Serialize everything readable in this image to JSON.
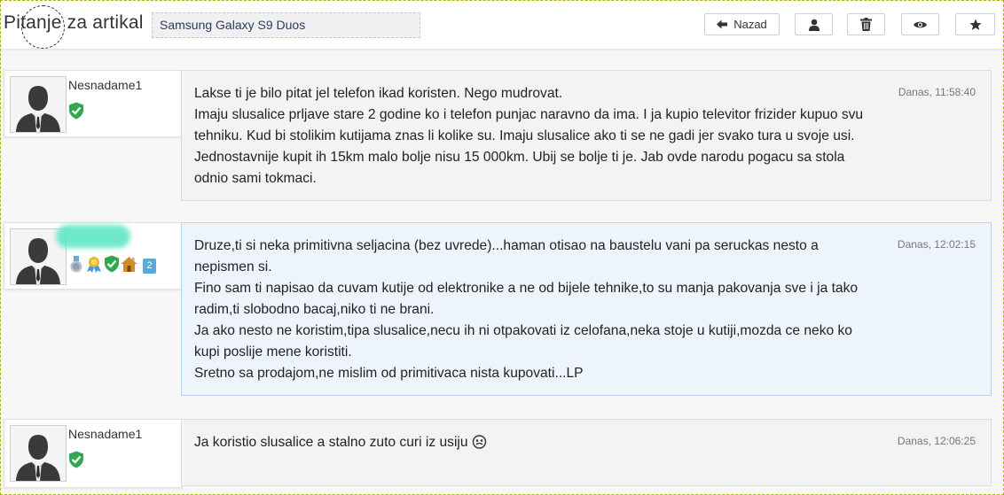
{
  "header": {
    "title": "Pitanje za artikal",
    "article_name": "Samsung Galaxy S9 Duos",
    "back_label": "Nazad"
  },
  "icons": {
    "back": "arrow-left-icon",
    "user": "user-icon",
    "trash": "trash-icon",
    "eye": "eye-icon",
    "star": "star-icon",
    "verified": "shield-check-icon"
  },
  "colors": {
    "verified_green": "#2fa84f",
    "count_badge": "#5aa9d9",
    "highlight_border": "#b8d4ec"
  },
  "posts": [
    {
      "author": "Nesnadame1",
      "time": "Danas, 11:58:40",
      "text": "Lakse ti je bilo pitat jel telefon ikad koristen. Nego mudrovat.\nImaju slusalice prljave stare 2 godine ko i telefon punjac naravno da ima. I ja kupio televitor frizider kupuo svu tehniku. Kud bi stolikim kutijama znas li kolike su. Imaju slusalice ako ti se ne gadi jer svako tura u svoje usi. Jednostavnije kupit ih 15km malo bolje nisu 15 000km. Ubij se bolje ti je. Jab ovde narodu pogacu sa stola odnio sami tokmaci."
    },
    {
      "author": "",
      "time": "Danas, 12:02:15",
      "badge_count": "2",
      "text": "Druze,ti si neka primitivna seljacina (bez uvrede)...haman otisao na baustelu vani pa seruckas nesto a nepismen si.\nFino sam ti napisao da cuvam kutije od elektronike a ne od bijele tehnike,to su manja pakovanja sve i ja tako radim,ti slobodno bacaj,niko ti ne brani.\nJa ako nesto ne koristim,tipa slusalice,necu ih ni otpakovati iz celofana,neka stoje u kutiji,mozda ce neko ko kupi poslije mene koristiti.\nSretno sa prodajom,ne mislim od primitivaca nista kupovati...LP"
    },
    {
      "author": "Nesnadame1",
      "time": "Danas, 12:06:25",
      "text": "Ja koristio slusalice a stalno zuto curi iz usiju"
    }
  ]
}
